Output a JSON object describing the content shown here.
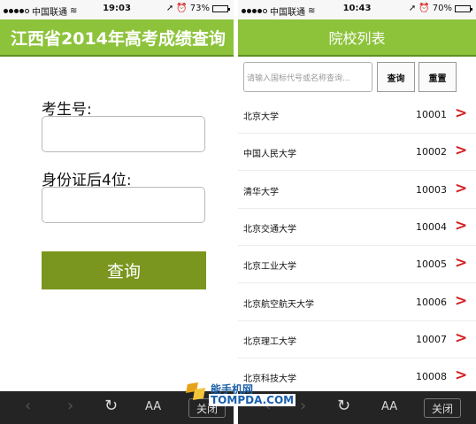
{
  "left": {
    "status": {
      "carrier": "中国联通",
      "time": "19:03",
      "battery": "73%",
      "battery_level": 0.73
    },
    "title": "江西省2014年高考成绩查询",
    "form": {
      "exam_no_label": "考生号:",
      "exam_no_value": "",
      "id_label": "身份证后4位:",
      "id_value": "",
      "submit_label": "查询"
    },
    "toolbar": {
      "back": "‹",
      "forward": "›",
      "reload": "↻",
      "font": "AA",
      "close": "关闭"
    }
  },
  "right": {
    "status": {
      "carrier": "中国联通",
      "time": "10:43",
      "battery": "70%",
      "battery_level": 0.7
    },
    "title": "院校列表",
    "search": {
      "placeholder": "请输入国标代号或名称查询...",
      "query_label": "查询",
      "reset_label": "重置"
    },
    "schools": [
      {
        "name": "北京大学",
        "code": "10001",
        "arrow": ">"
      },
      {
        "name": "中国人民大学",
        "code": "10002",
        "arrow": ">"
      },
      {
        "name": "清华大学",
        "code": "10003",
        "arrow": ">"
      },
      {
        "name": "北京交通大学",
        "code": "10004",
        "arrow": ">"
      },
      {
        "name": "北京工业大学",
        "code": "10005",
        "arrow": ">"
      },
      {
        "name": "北京航空航天大学",
        "code": "10006",
        "arrow": ">"
      },
      {
        "name": "北京理工大学",
        "code": "10007",
        "arrow": ">"
      },
      {
        "name": "北京科技大学",
        "code": "10008",
        "arrow": ">"
      }
    ],
    "toolbar": {
      "back": "‹",
      "forward": "›",
      "reload": "↻",
      "font": "AA",
      "close": "关闭"
    }
  },
  "watermark": {
    "cn": "能手机网",
    "en": "TOMPDA.COM"
  },
  "colors": {
    "header": "#8dc33b",
    "button": "#7a961e",
    "arrow": "#d51f1f",
    "toolbar": "#242424"
  }
}
